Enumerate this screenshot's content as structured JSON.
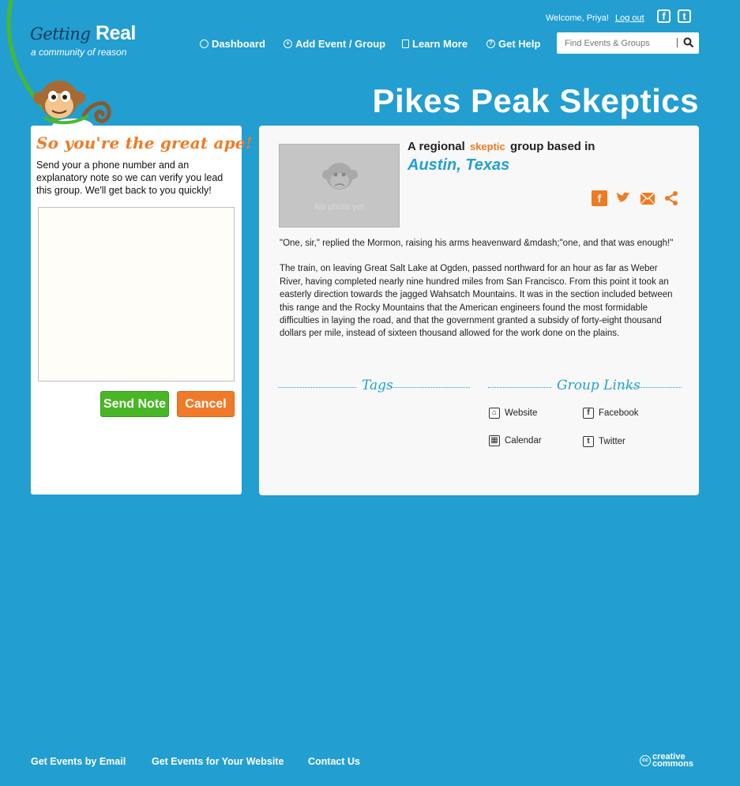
{
  "header": {
    "logo_word1": "Getting",
    "logo_word2": "Real",
    "tagline": "a community of reason",
    "welcome": "Welcome, Priya!",
    "logout": "Log out",
    "nav": [
      "Dashboard",
      "Add Event / Group",
      "Learn More",
      "Get Help"
    ],
    "search_placeholder": "Find Events & Groups"
  },
  "page_title": "Pikes Peak Skeptics",
  "note_panel": {
    "title": "So you're the great ape!",
    "text": "Send your a phone number and an explanatory note so we can verify you lead this group. We'll get back to you quickly!",
    "textarea_value": "",
    "send_label": "Send Note",
    "cancel_label": "Cancel"
  },
  "group": {
    "photo_caption": "No photo yet",
    "regional_pre": "A regional",
    "regional_type": "skeptic",
    "regional_post": "group based in",
    "location": "Austin, Texas",
    "description": [
      "\"One, sir,\" replied the Mormon, raising his arms heavenward &mdash;\"one, and that was enough!\"",
      "The train, on leaving Great Salt Lake at Ogden, passed northward for an hour as far as Weber River, having completed nearly nine hundred miles from San Francisco.  From this point it took an easterly direction towards the jagged Wahsatch Mountains.  It was in the section included between this range and the Rocky Mountains that the American engineers found the most formidable difficulties in laying the road, and that the government granted a subsidy of forty-eight thousand dollars per mile, instead of sixteen thousand allowed for the work done on the plains."
    ],
    "tags_title": "Tags",
    "links_title": "Group Links",
    "links": {
      "website": "Website",
      "facebook": "Facebook",
      "calendar": "Calendar",
      "twitter": "Twitter"
    }
  },
  "footer": {
    "links": [
      "Get Events by Email",
      "Get Events for Your Website",
      "Contact Us"
    ],
    "cc_line1": "creative",
    "cc_line2": "commons"
  },
  "colors": {
    "background": "#229ed1",
    "accent_orange": "#ee7b23",
    "accent_green": "#49b626",
    "accent_blue": "#23a0d2"
  }
}
